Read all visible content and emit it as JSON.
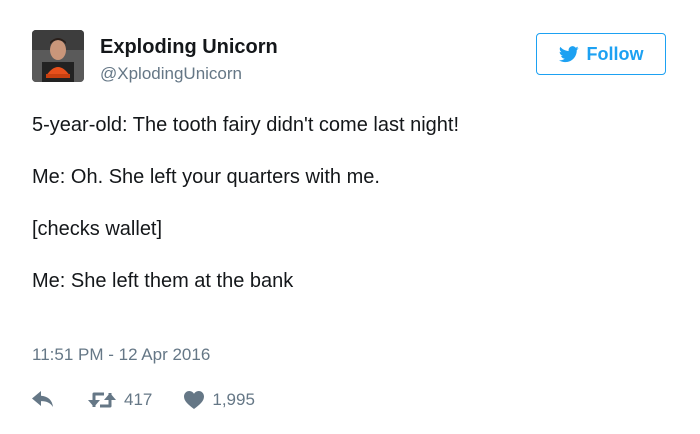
{
  "author": {
    "name": "Exploding Unicorn",
    "handle": "@XplodingUnicorn"
  },
  "follow_button": {
    "label": "Follow",
    "icon": "twitter-bird-icon"
  },
  "tweet": {
    "lines": [
      "5-year-old: The tooth fairy didn't come last night!",
      "Me: Oh. She left your quarters with me.",
      "[checks wallet]",
      "Me: She left them at the bank"
    ],
    "timestamp": "11:51 PM - 12 Apr 2016"
  },
  "actions": {
    "reply_icon": "reply-icon",
    "retweet_icon": "retweet-icon",
    "retweet_count": "417",
    "like_icon": "heart-icon",
    "like_count": "1,995"
  },
  "colors": {
    "accent": "#1da1f2",
    "muted": "#657786",
    "text": "#14171a"
  }
}
